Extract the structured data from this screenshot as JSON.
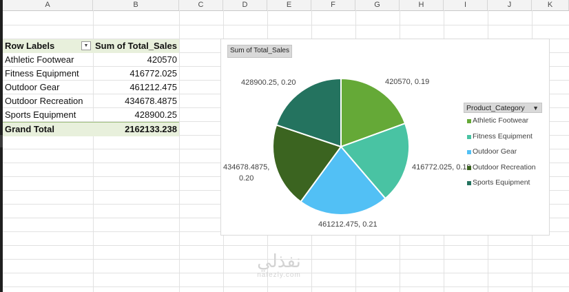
{
  "spreadsheet": {
    "columns": [
      "A",
      "B",
      "C",
      "D",
      "E",
      "F",
      "G",
      "H",
      "I",
      "J",
      "K"
    ]
  },
  "pivot": {
    "header": {
      "row_labels": "Row Labels",
      "sum_label": "Sum of Total_Sales"
    },
    "rows": [
      {
        "label": "Athletic Footwear",
        "value": "420570"
      },
      {
        "label": "Fitness Equipment",
        "value": "416772.025"
      },
      {
        "label": "Outdoor Gear",
        "value": "461212.475"
      },
      {
        "label": "Outdoor Recreation",
        "value": "434678.4875"
      },
      {
        "label": "Sports Equipment",
        "value": "428900.25"
      }
    ],
    "total": {
      "label": "Grand Total",
      "value": "2162133.238"
    }
  },
  "chart": {
    "field_button": "Sum of Total_Sales",
    "legend_title": "Product_Category"
  },
  "chart_data": {
    "type": "pie",
    "categories": [
      "Athletic Footwear",
      "Fitness Equipment",
      "Outdoor Gear",
      "Outdoor Recreation",
      "Sports Equipment"
    ],
    "values": [
      420570,
      416772.025,
      461212.475,
      434678.4875,
      428900.25
    ],
    "colors": [
      "#65a937",
      "#49c3a3",
      "#52c0f5",
      "#3b6420",
      "#24735f"
    ],
    "data_labels": [
      "420570, 0.19",
      "416772.025, 0.19",
      "461212.475, 0.21",
      "434678.4875, 0.20",
      "428900.25, 0.20"
    ],
    "legend": "right"
  },
  "watermark": {
    "arabic": "نفذلي",
    "latin": "nafezly.com"
  }
}
